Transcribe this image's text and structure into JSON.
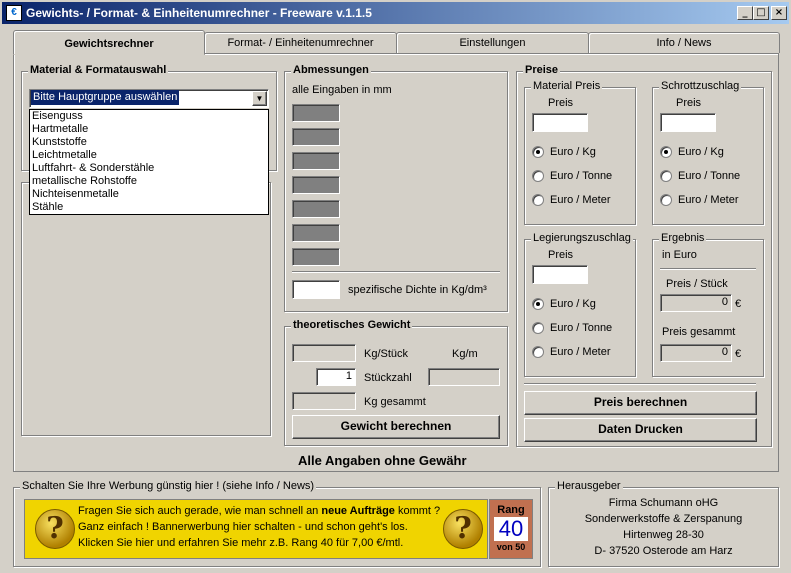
{
  "window": {
    "title": "Gewichts- / Format- & Einheitenumrechner - Freeware v.1.1.5",
    "icon": "app-icon",
    "minimize": "_",
    "maximize": "□",
    "close": "×"
  },
  "tabs": [
    {
      "label": "Gewichtsrechner",
      "active": true
    },
    {
      "label": "Format- / Einheitenumrechner",
      "active": false
    },
    {
      "label": "Einstellungen",
      "active": false
    },
    {
      "label": "Info / News",
      "active": false
    }
  ],
  "material": {
    "group_label": "Material & Formatauswahl",
    "select_value": "Bitte Hauptgruppe auswählen",
    "options": [
      "Eisenguss",
      "Hartmetalle",
      "Kunststoffe",
      "Leichtmetalle",
      "Luftfahrt- & Sonderstähle",
      "metallische Rohstoffe",
      "Nichteisenmetalle",
      "Stähle"
    ]
  },
  "abmessungen": {
    "group_label": "Abmessungen",
    "note": "alle Eingaben in mm",
    "density_label": "spezifische Dichte in Kg/dm³",
    "density_value": ""
  },
  "gewicht": {
    "group_label": "theoretisches Gewicht",
    "kg_stueck": "Kg/Stück",
    "kg_m": "Kg/m",
    "stueckzahl_label": "Stückzahl",
    "stueckzahl_value": "1",
    "kg_gesamt": "Kg gesammt",
    "button": "Gewicht berechnen"
  },
  "preise": {
    "group_label": "Preise",
    "material": {
      "label": "Material Preis",
      "sub": "Preis",
      "options": [
        "Euro / Kg",
        "Euro / Tonne",
        "Euro / Meter"
      ],
      "selected": 0
    },
    "schrott": {
      "label": "Schrottzuschlag",
      "sub": "Preis",
      "options": [
        "Euro / Kg",
        "Euro / Tonne",
        "Euro / Meter"
      ],
      "selected": 0
    },
    "legierung": {
      "label": "Legierungszuschlag",
      "sub": "Preis",
      "options": [
        "Euro / Kg",
        "Euro / Tonne",
        "Euro / Meter"
      ],
      "selected": 0
    },
    "ergebnis": {
      "label": "Ergebnis",
      "unit": "in Euro",
      "preis_stueck_label": "Preis / Stück",
      "preis_stueck_value": "0",
      "currency": "€",
      "preis_gesamt_label": "Preis gesammt",
      "preis_gesamt_value": "0"
    },
    "btn_calc": "Preis berechnen",
    "btn_print": "Daten Drucken"
  },
  "disclaimer": "Alle Angaben ohne Gewähr",
  "werbung": {
    "group_label": "Schalten Sie Ihre Werbung günstig hier ! (siehe Info / News)",
    "line1_pre": "Fragen Sie sich auch gerade, wie man schnell an ",
    "line1_bold": "neue Aufträge",
    "line1_post": " kommt ?",
    "line2": "Ganz einfach ! Bannerwerbung hier schalten - und schon geht's los.",
    "line3": "Klicken Sie hier und erfahren Sie mehr   z.B. Rang 40 für 7,00 €/mtl.",
    "rank_label": "Rang",
    "rank_value": "40",
    "rank_of": "von 50"
  },
  "herausgeber": {
    "group_label": "Herausgeber",
    "lines": [
      "Firma Schumann oHG",
      "Sonderwerkstoffe & Zerspanung",
      "Hirtenweg 28-30",
      "D- 37520 Osterode am Harz"
    ]
  }
}
